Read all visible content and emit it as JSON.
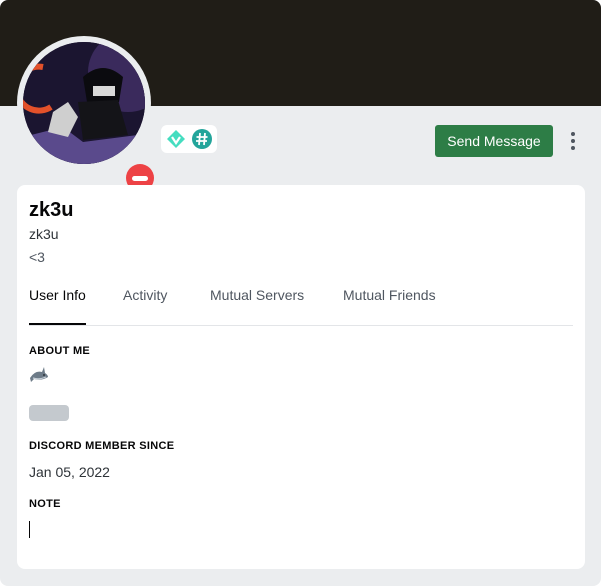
{
  "profile": {
    "display_name": "zk3u",
    "username": "zk3u",
    "custom_status": "<3",
    "status": "do-not-disturb"
  },
  "header": {
    "badges": [
      "hypesquad-balance-badge",
      "hashtag-badge"
    ],
    "send_message_label": "Send Message",
    "banner_color": "#201d17"
  },
  "tabs": [
    {
      "label": "User Info",
      "active": true
    },
    {
      "label": "Activity",
      "active": false
    },
    {
      "label": "Mutual Servers",
      "active": false
    },
    {
      "label": "Mutual Friends",
      "active": false
    }
  ],
  "about": {
    "title": "ABOUT ME",
    "emoji": "shark-emoji"
  },
  "member_since": {
    "title": "DISCORD MEMBER SINCE",
    "date": "Jan 05, 2022"
  },
  "note": {
    "title": "NOTE",
    "value": "",
    "placeholder": ""
  },
  "colors": {
    "accent_green": "#2d7d46",
    "dnd_red": "#ed4245",
    "badge_teal": "#23a59b"
  }
}
